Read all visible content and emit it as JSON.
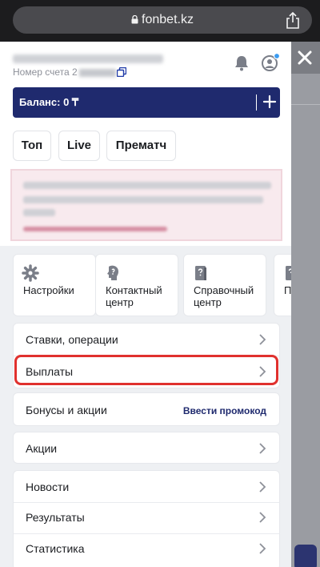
{
  "browser": {
    "url": "fonbet.kz",
    "icons": [
      "lock-icon",
      "share-icon"
    ]
  },
  "header": {
    "account_label": "Номер счета",
    "account_visible_prefix": "2",
    "icons": [
      "copy-icon",
      "bell-icon",
      "profile-icon"
    ],
    "notification_dot_color": "#3b9bf0"
  },
  "balance": {
    "label": "Баланс: 0 ₸",
    "add_icon": "plus-icon",
    "bar_color": "#1f2a6e"
  },
  "tabs": [
    {
      "label": "Топ"
    },
    {
      "label": "Live"
    },
    {
      "label": "Прематч"
    }
  ],
  "tiles": [
    {
      "label": "Настройки",
      "icon": "gear-icon"
    },
    {
      "label": "Контактный\nцентр",
      "icon": "contact-center-icon"
    },
    {
      "label": "Справочный\nцентр",
      "icon": "help-book-icon"
    },
    {
      "label": "П",
      "icon": "document-icon"
    }
  ],
  "rows": {
    "bets": "Ставки, операции",
    "payouts": "Выплаты",
    "bonuses": "Бонусы и акции",
    "promo_code": "Ввести промокод",
    "promotions": "Акции",
    "news": "Новости",
    "results": "Результаты",
    "statistics": "Статистика"
  },
  "highlight_color": "#e0312e",
  "background_close_icon": "close-icon"
}
